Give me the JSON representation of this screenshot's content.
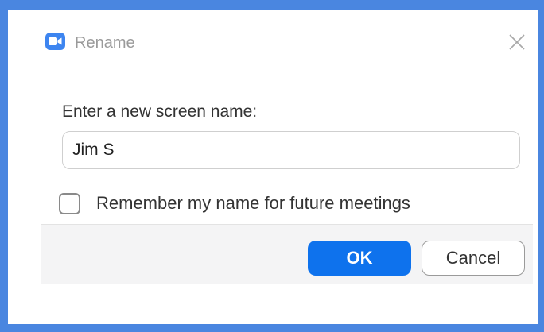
{
  "window": {
    "title": "Rename",
    "app_icon": "zoom-camera-icon",
    "close_icon": "close-icon"
  },
  "form": {
    "prompt": "Enter a new screen name:",
    "name_value": "Jim S",
    "remember_label": "Remember my name for future meetings",
    "remember_checked": false
  },
  "buttons": {
    "ok_label": "OK",
    "cancel_label": "Cancel"
  },
  "colors": {
    "frame": "#4a86e0",
    "accent": "#0e72ed",
    "app_icon_bg": "#3d85f0"
  }
}
